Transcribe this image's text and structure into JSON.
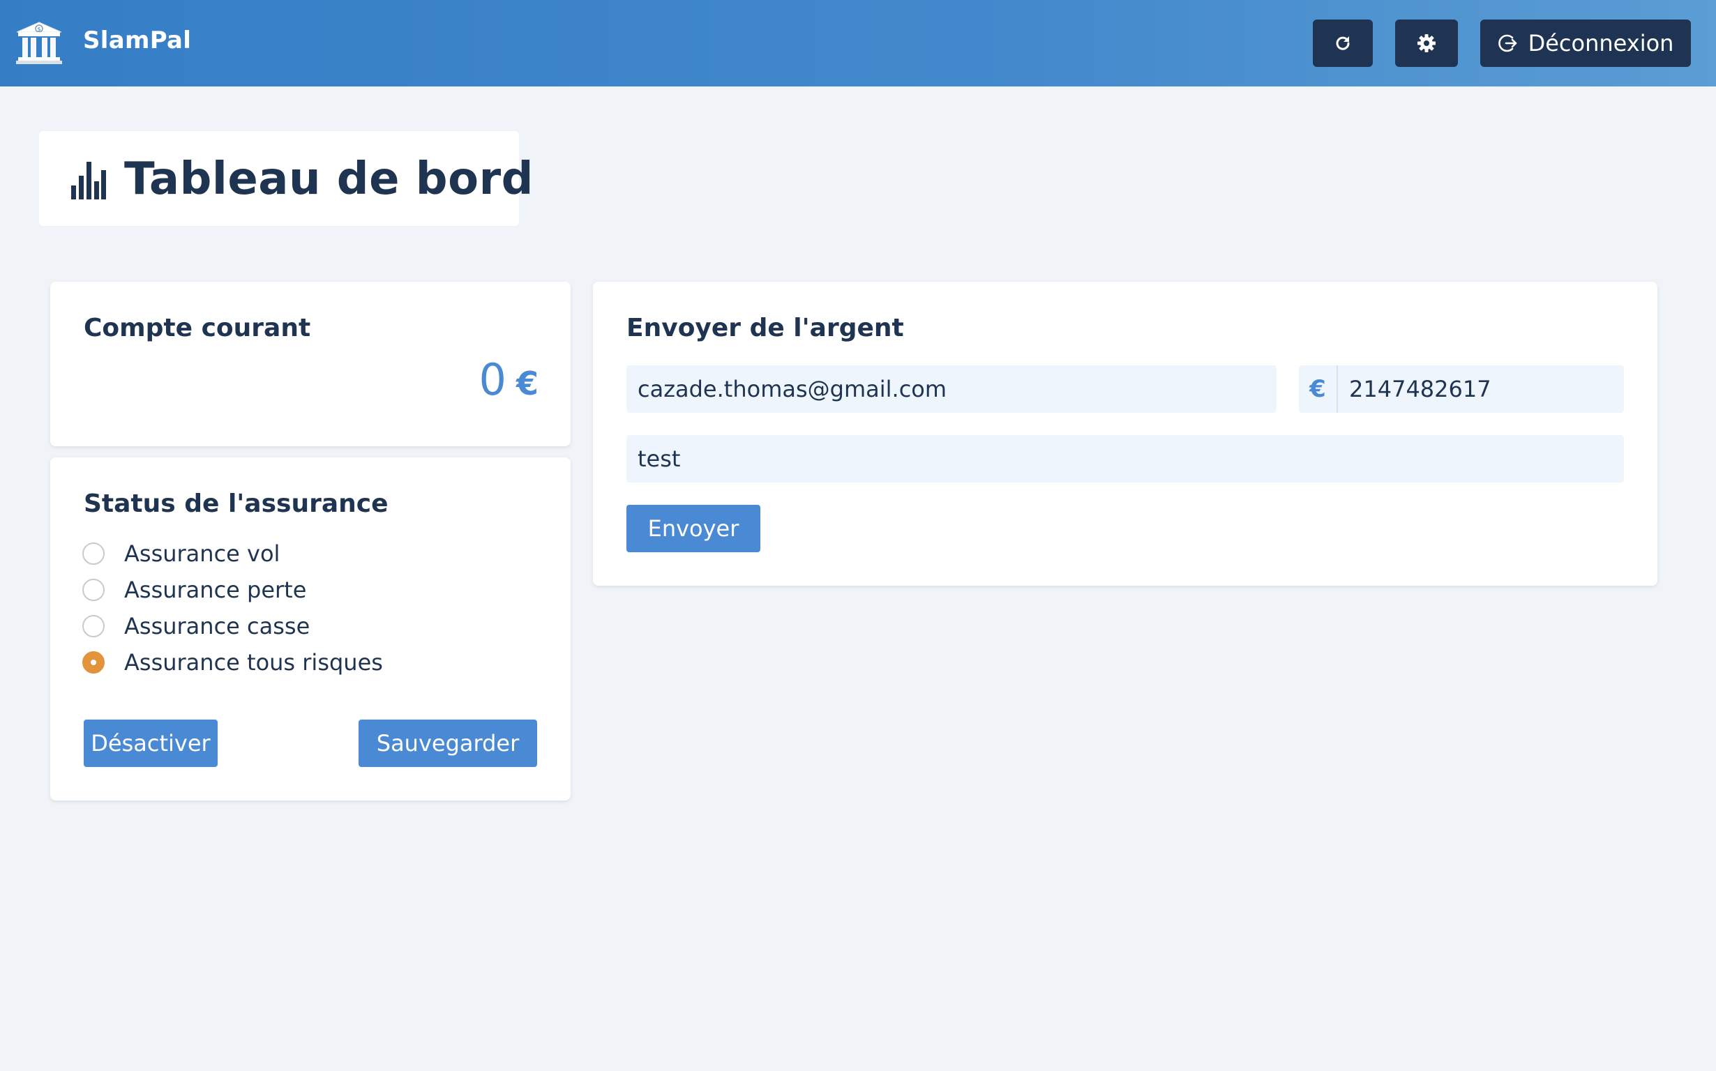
{
  "app": {
    "name": "SlamPal",
    "logo_icon": "bank-icon"
  },
  "header": {
    "refresh_icon": "refresh-icon",
    "settings_icon": "gear-icon",
    "logout_icon": "logout-icon",
    "logout_label": "Déconnexion"
  },
  "page": {
    "title": "Tableau de bord",
    "title_icon": "bar-chart-icon"
  },
  "account": {
    "heading": "Compte courant",
    "balance": "0",
    "currency": "€"
  },
  "insurance": {
    "heading": "Status de l'assurance",
    "options": [
      {
        "label": "Assurance vol",
        "checked": false
      },
      {
        "label": "Assurance perte",
        "checked": false
      },
      {
        "label": "Assurance casse",
        "checked": false
      },
      {
        "label": "Assurance tous risques",
        "checked": true
      }
    ],
    "deactivate_label": "Désactiver",
    "save_label": "Sauvegarder"
  },
  "transfer": {
    "heading": "Envoyer de l'argent",
    "email_value": "cazade.thomas@gmail.com",
    "currency_symbol": "€",
    "amount_value": "2147482617",
    "message_value": "test",
    "send_label": "Envoyer"
  },
  "colors": {
    "header_gradient_start": "#357ec6",
    "header_gradient_end": "#5b9dd4",
    "dark_button": "#1f3352",
    "primary": "#4a8ad4",
    "radio_checked": "#e3933a",
    "background": "#f0f4f8",
    "input_background": "#eef5fd",
    "text": "#1f3450"
  }
}
